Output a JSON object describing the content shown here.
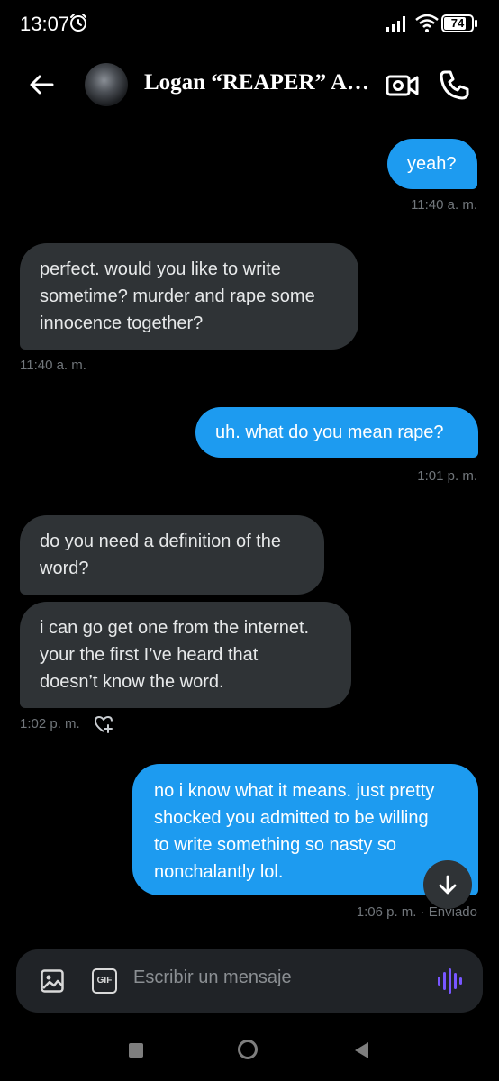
{
  "status": {
    "time": "13:07",
    "battery": "74"
  },
  "header": {
    "contact_name": "Logan “REAPER” An..."
  },
  "messages": [
    {
      "dir": "sent",
      "lines": [
        "yeah?"
      ],
      "time": "11:40 a. m."
    },
    {
      "dir": "recv",
      "lines": [
        "perfect. would you like to write",
        "sometime? murder and rape some",
        "innocence together?"
      ],
      "time": "11:40 a. m."
    },
    {
      "dir": "sent",
      "lines": [
        "uh. what do you mean rape?"
      ],
      "time": "1:01 p. m."
    },
    {
      "dir": "recv",
      "lines": [
        "do you need a definition of the",
        "word?"
      ]
    },
    {
      "dir": "recv",
      "lines": [
        "i can go get one from the internet.",
        "your the first I’ve heard that",
        "doesn’t know the word."
      ],
      "time": "1:02 p. m."
    },
    {
      "dir": "sent",
      "lines": [
        "no i know what it means. just pretty",
        "shocked you admitted to be willing",
        "to write something so nasty so",
        "nonchalantly lol."
      ],
      "time": "1:06 p. m. · Enviado"
    }
  ],
  "composer": {
    "placeholder": "Escribir un mensaje",
    "gif_label": "GIF"
  },
  "icons": [
    "alarm-icon",
    "signal-icon",
    "wifi-icon",
    "battery-icon",
    "back-arrow-icon",
    "video-call-icon",
    "phone-icon",
    "heart-plus-icon",
    "arrow-down-icon",
    "image-icon",
    "gif-icon",
    "voice-wave-icon"
  ],
  "colors": {
    "sent_bubble": "#1d9bf0",
    "received_bubble": "#2f3336",
    "accent_voice": "#7856ff",
    "timestamp": "#71767b"
  }
}
